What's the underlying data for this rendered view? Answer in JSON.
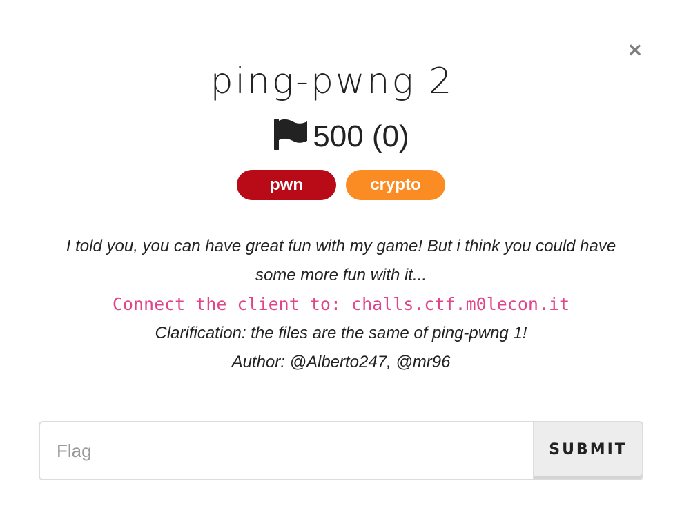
{
  "modal": {
    "close_label": "×",
    "title": "ping-pwng 2",
    "points": {
      "icon": "flag-icon",
      "text": "500 (0)"
    },
    "tags": [
      {
        "label": "pwn",
        "color": "#b80a17"
      },
      {
        "label": "crypto",
        "color": "#fb8c24"
      }
    ],
    "description": {
      "intro_line1": "I told you, you can have great fun with my game! But i think you could have",
      "intro_line2": "some more fun with it...",
      "connect": "Connect the client to: challs.ctf.m0lecon.it",
      "connect_color": "#e0458a",
      "clarification": "Clarification: the files are the same of ping-pwng 1!",
      "author": "Author: @Alberto247, @mr96"
    },
    "form": {
      "flag_placeholder": "Flag",
      "flag_value": "",
      "submit_label": "SUBMIT"
    }
  }
}
